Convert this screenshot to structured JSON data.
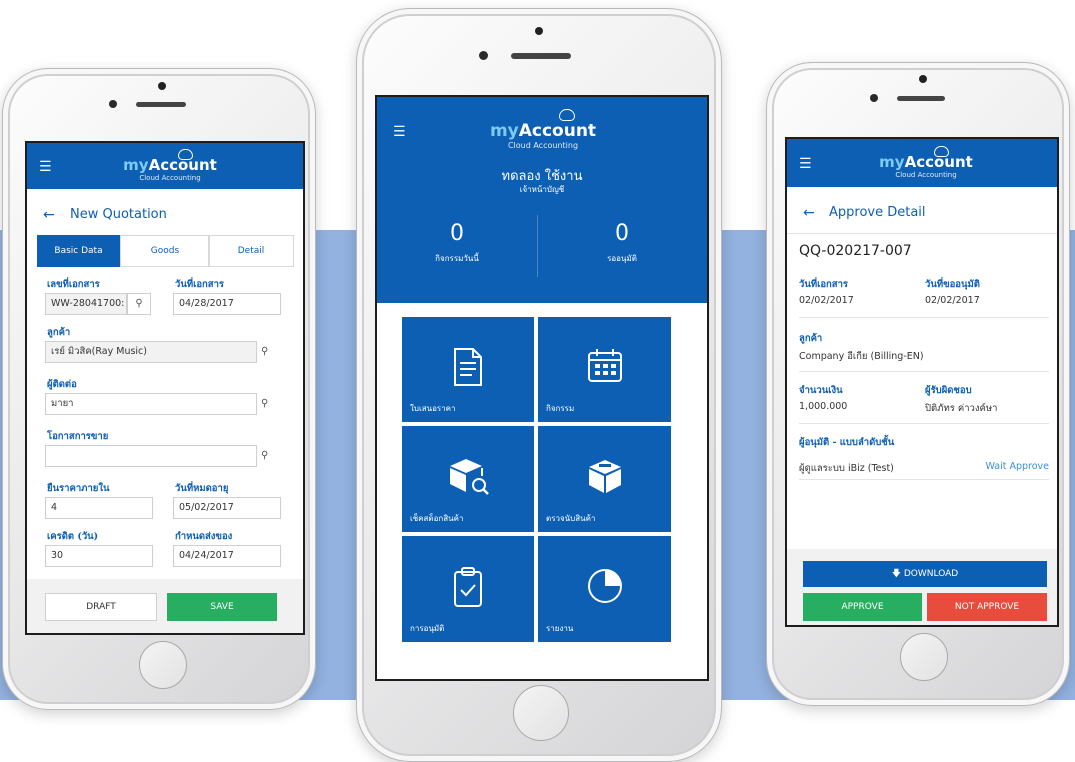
{
  "brand": {
    "my": "my",
    "account": "Account",
    "sub": "Cloud Accounting"
  },
  "left": {
    "title": "New Quotation",
    "tabs": [
      "Basic Data",
      "Goods",
      "Detail"
    ],
    "fields": {
      "doc_no_label": "เลขที่เอกสาร",
      "doc_no": "WW-28041700:",
      "doc_date_label": "วันที่เอกสาร",
      "doc_date": "04/28/2017",
      "customer_label": "ลูกค้า",
      "customer": "เรย์ มิวสิค(Ray Music)",
      "contact_label": "ผู้ติดต่อ",
      "contact": "มายา",
      "opportunity_label": "โอกาสการขาย",
      "opportunity": "",
      "price_confirm_label": "ยืนราคาภายใน",
      "price_confirm": "4",
      "expire_label": "วันที่หมดอายุ",
      "expire": "05/02/2017",
      "credit_label": "เครดิต (วัน)",
      "credit": "30",
      "delivery_label": "กำหนดส่งของ",
      "delivery": "04/24/2017"
    },
    "draft": "DRAFT",
    "save": "SAVE"
  },
  "center": {
    "user_name": "ทดลอง ใช้งาน",
    "user_role": "เจ้าหน้าบัญชี",
    "stats": [
      {
        "value": "0",
        "label": "กิจกรรมวันนี้"
      },
      {
        "value": "0",
        "label": "รออนุมัติ"
      }
    ],
    "tiles": [
      {
        "label": "ใบเสนอราคา",
        "icon": "document-icon"
      },
      {
        "label": "กิจกรรม",
        "icon": "calendar-icon"
      },
      {
        "label": "เช็คสต็อกสินค้า",
        "icon": "stock-search-icon"
      },
      {
        "label": "ตรวจนับสินค้า",
        "icon": "box-icon"
      },
      {
        "label": "การอนุมัติ",
        "icon": "clipboard-check-icon"
      },
      {
        "label": "รายงาน",
        "icon": "pie-chart-icon"
      }
    ]
  },
  "right": {
    "title": "Approve Detail",
    "doc_no": "QQ-020217-007",
    "doc_date_label": "วันที่เอกสาร",
    "doc_date": "02/02/2017",
    "req_date_label": "วันที่ขออนุมัติ",
    "req_date": "02/02/2017",
    "customer_label": "ลูกค้า",
    "customer": "Company อีเกีย (Billing-EN)",
    "amount_label": "จำนวนเงิน",
    "amount": "1,000.000",
    "owner_label": "ผู้รับผิดชอบ",
    "owner": "ปิติภัทร ค่าวงค์ษา",
    "approver_label": "ผู้อนุมัติ - แบบลำดับชั้น",
    "approver": "ผู้ดูแลระบบ iBiz (Test)",
    "approver_status": "Wait Approve",
    "download": "DOWNLOAD",
    "approve": "APPROVE",
    "not_approve": "NOT APPROVE"
  },
  "colors": {
    "primary": "#0d5fb4",
    "save": "#27ae60",
    "approve": "#27ae60",
    "reject": "#e74c3c",
    "band": "#93b2e0"
  }
}
